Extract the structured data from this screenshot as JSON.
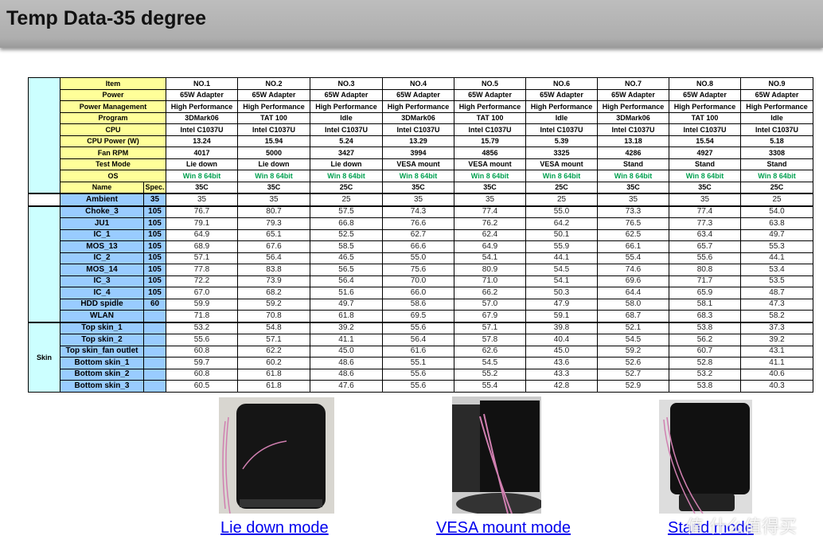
{
  "title": "Temp Data-35 degree",
  "table": {
    "columns": [
      "NO.1",
      "NO.2",
      "NO.3",
      "NO.4",
      "NO.5",
      "NO.6",
      "NO.7",
      "NO.8",
      "NO.9"
    ],
    "config_rows": [
      {
        "label": "Item",
        "values": [
          "NO.1",
          "NO.2",
          "NO.3",
          "NO.4",
          "NO.5",
          "NO.6",
          "NO.7",
          "NO.8",
          "NO.9"
        ]
      },
      {
        "label": "Power",
        "values": [
          "65W Adapter",
          "65W Adapter",
          "65W Adapter",
          "65W Adapter",
          "65W Adapter",
          "65W Adapter",
          "65W Adapter",
          "65W Adapter",
          "65W Adapter"
        ]
      },
      {
        "label": "Power Management",
        "values": [
          "High Performance",
          "High Performance",
          "High Performance",
          "High Performance",
          "High Performance",
          "High Performance",
          "High Performance",
          "High Performance",
          "High Performance"
        ]
      },
      {
        "label": "Program",
        "values": [
          "3DMark06",
          "TAT 100",
          "Idle",
          "3DMark06",
          "TAT 100",
          "Idle",
          "3DMark06",
          "TAT 100",
          "Idle"
        ]
      },
      {
        "label": "CPU",
        "values": [
          "Intel C1037U",
          "Intel C1037U",
          "Intel C1037U",
          "Intel C1037U",
          "Intel C1037U",
          "Intel C1037U",
          "Intel C1037U",
          "Intel C1037U",
          "Intel C1037U"
        ]
      },
      {
        "label": "CPU Power (W)",
        "values": [
          "13.24",
          "15.94",
          "5.24",
          "13.29",
          "15.79",
          "5.39",
          "13.18",
          "15.54",
          "5.18"
        ]
      },
      {
        "label": "Fan RPM",
        "values": [
          "4017",
          "5000",
          "3427",
          "3994",
          "4856",
          "3325",
          "4286",
          "4927",
          "3308"
        ]
      },
      {
        "label": "Test Mode",
        "values": [
          "Lie down",
          "Lie down",
          "Lie down",
          "VESA mount",
          "VESA mount",
          "VESA mount",
          "Stand",
          "Stand",
          "Stand"
        ]
      },
      {
        "label": "OS",
        "values": [
          "Win 8 64bit",
          "Win 8 64bit",
          "Win 8 64bit",
          "Win 8 64bit",
          "Win 8 64bit",
          "Win 8 64bit",
          "Win 8 64bit",
          "Win 8 64bit",
          "Win 8 64bit"
        ]
      }
    ],
    "name_row": {
      "label": "Name",
      "spec": "Spec.",
      "values": [
        "35C",
        "35C",
        "25C",
        "35C",
        "35C",
        "25C",
        "35C",
        "35C",
        "25C"
      ]
    },
    "ambient": {
      "label": "Ambient",
      "spec": "35",
      "values": [
        "35",
        "35",
        "25",
        "35",
        "35",
        "25",
        "35",
        "35",
        "25"
      ]
    },
    "components": [
      {
        "label": "Choke_3",
        "spec": "105",
        "values": [
          "76.7",
          "80.7",
          "57.5",
          "74.3",
          "77.4",
          "55.0",
          "73.3",
          "77.4",
          "54.0"
        ]
      },
      {
        "label": "JU1",
        "spec": "105",
        "values": [
          "79.1",
          "79.3",
          "66.8",
          "76.6",
          "76.2",
          "64.2",
          "76.5",
          "77.3",
          "63.8"
        ]
      },
      {
        "label": "IC_1",
        "spec": "105",
        "values": [
          "64.9",
          "65.1",
          "52.5",
          "62.7",
          "62.4",
          "50.1",
          "62.5",
          "63.4",
          "49.7"
        ]
      },
      {
        "label": "MOS_13",
        "spec": "105",
        "values": [
          "68.9",
          "67.6",
          "58.5",
          "66.6",
          "64.9",
          "55.9",
          "66.1",
          "65.7",
          "55.3"
        ]
      },
      {
        "label": "IC_2",
        "spec": "105",
        "values": [
          "57.1",
          "56.4",
          "46.5",
          "55.0",
          "54.1",
          "44.1",
          "55.4",
          "55.6",
          "44.1"
        ]
      },
      {
        "label": "MOS_14",
        "spec": "105",
        "values": [
          "77.8",
          "83.8",
          "56.5",
          "75.6",
          "80.9",
          "54.5",
          "74.6",
          "80.8",
          "53.4"
        ]
      },
      {
        "label": "IC_3",
        "spec": "105",
        "values": [
          "72.2",
          "73.9",
          "56.4",
          "70.0",
          "71.0",
          "54.1",
          "69.6",
          "71.7",
          "53.5"
        ]
      },
      {
        "label": "IC_4",
        "spec": "105",
        "values": [
          "67.0",
          "68.2",
          "51.6",
          "66.0",
          "66.2",
          "50.3",
          "64.4",
          "65.9",
          "48.7"
        ]
      },
      {
        "label": "HDD spidle",
        "spec": "60",
        "values": [
          "59.9",
          "59.2",
          "49.7",
          "58.6",
          "57.0",
          "47.9",
          "58.0",
          "58.1",
          "47.3"
        ]
      },
      {
        "label": "WLAN",
        "spec": "",
        "values": [
          "71.8",
          "70.8",
          "61.8",
          "69.5",
          "67.9",
          "59.1",
          "68.7",
          "68.3",
          "58.2"
        ]
      }
    ],
    "skin_group_label": "Skin",
    "skin": [
      {
        "label": "Top skin_1",
        "spec": "",
        "values": [
          "53.2",
          "54.8",
          "39.2",
          "55.6",
          "57.1",
          "39.8",
          "52.1",
          "53.8",
          "37.3"
        ]
      },
      {
        "label": "Top skin_2",
        "spec": "",
        "values": [
          "55.6",
          "57.1",
          "41.1",
          "56.4",
          "57.8",
          "40.4",
          "54.5",
          "56.2",
          "39.2"
        ]
      },
      {
        "label": "Top skin_fan outlet",
        "spec": "",
        "values": [
          "60.8",
          "62.2",
          "45.0",
          "61.6",
          "62.6",
          "45.0",
          "59.2",
          "60.7",
          "43.1"
        ]
      },
      {
        "label": "Bottom skin_1",
        "spec": "",
        "values": [
          "59.7",
          "60.2",
          "48.6",
          "55.1",
          "54.5",
          "43.6",
          "52.6",
          "52.8",
          "41.1"
        ]
      },
      {
        "label": "Bottom skin_2",
        "spec": "",
        "values": [
          "60.8",
          "61.8",
          "48.6",
          "55.6",
          "55.2",
          "43.3",
          "52.7",
          "53.2",
          "40.6"
        ]
      },
      {
        "label": "Bottom skin_3",
        "spec": "",
        "values": [
          "60.5",
          "61.8",
          "47.6",
          "55.6",
          "55.4",
          "42.8",
          "52.9",
          "53.8",
          "40.3"
        ]
      }
    ],
    "colors": {
      "header_label": "#ffff99",
      "sensor_label": "#99ccff",
      "group": "#ccffff",
      "os_text": "#00a050"
    }
  },
  "photos": [
    {
      "caption": "Lie down mode"
    },
    {
      "caption": "VESA mount mode"
    },
    {
      "caption": "Stand mode"
    }
  ],
  "watermark": "值 什么值得买"
}
